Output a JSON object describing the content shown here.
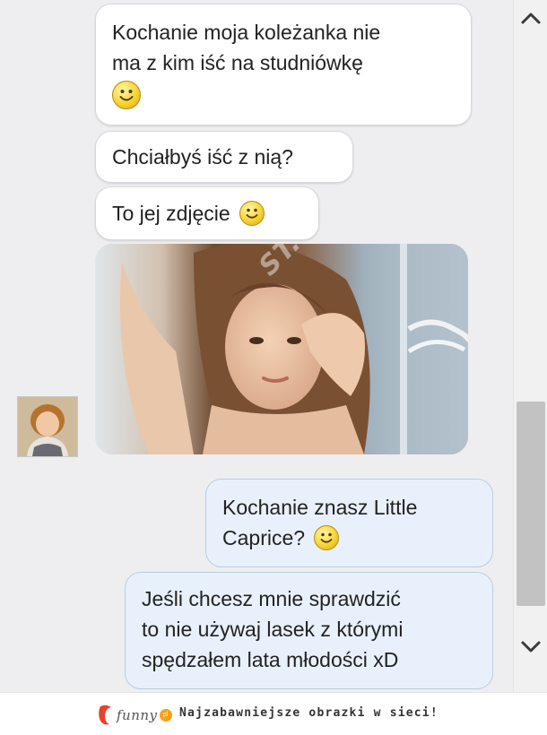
{
  "messages": [
    {
      "lines": [
        "Kochanie moja koleżanka nie",
        "ma z kim iść na studniówkę"
      ],
      "emoji": "smiley-icon"
    },
    {
      "lines": [
        "Chciałbyś iść z nią?"
      ]
    },
    {
      "lines": [
        "To jej zdjęcie"
      ],
      "emoji": "smiley-icon"
    },
    {
      "lines": [
        "Kochanie znasz Little",
        "Caprice?"
      ],
      "emoji": "smiley-icon"
    },
    {
      "lines": [
        "Jeśli chcesz mnie sprawdzić",
        "to nie używaj lasek z którymi",
        "spędzałem lata młodości xD"
      ]
    }
  ],
  "photo": {
    "watermark": "ST..."
  },
  "footer": {
    "logo": "funny",
    "logo_badge": "pl",
    "tagline": "Najzabawniejsze obrazki w sieci!"
  },
  "colors": {
    "incoming_bubble": "#ffffff",
    "outgoing_bubble": "#e8f1fb",
    "outgoing_border": "#b9cde4",
    "logo_accent": "#e8412c"
  },
  "icons": {
    "scroll_up": "chevron-up-icon",
    "scroll_down": "chevron-down-icon",
    "emoji": "smiley-icon"
  }
}
